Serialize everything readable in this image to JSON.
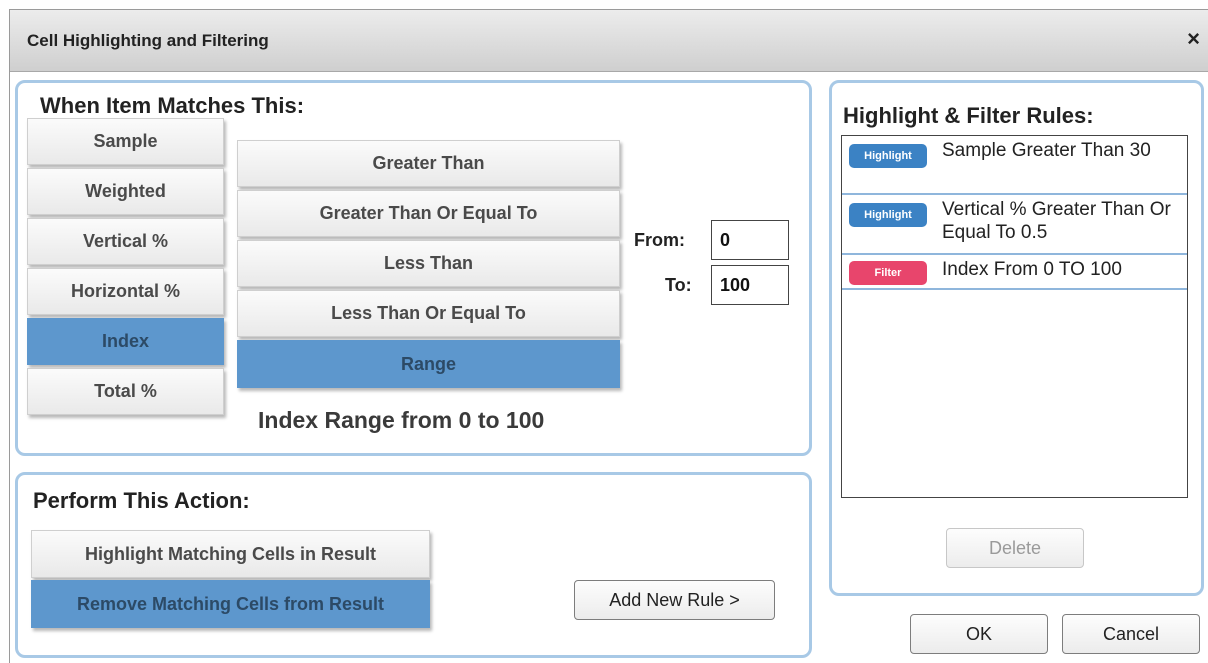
{
  "dialog": {
    "title": "Cell Highlighting and Filtering",
    "close_glyph": "×"
  },
  "match_panel": {
    "title": "When Item Matches This:",
    "fields": [
      "Sample",
      "Weighted",
      "Vertical %",
      "Horizontal %",
      "Index",
      "Total %"
    ],
    "selected_field": "Index",
    "conditions": [
      "Greater Than",
      "Greater Than Or Equal To",
      "Less Than",
      "Less Than Or Equal To",
      "Range"
    ],
    "selected_condition": "Range",
    "from_label": "From:",
    "from_value": "0",
    "to_label": "To:",
    "to_value": "100",
    "summary": "Index Range from 0 to 100"
  },
  "action_panel": {
    "title": "Perform This Action:",
    "actions": [
      "Highlight Matching Cells in Result",
      "Remove Matching Cells from Result"
    ],
    "selected_action": "Remove Matching Cells from Result",
    "add_rule_label": "Add New Rule >"
  },
  "rules_panel": {
    "title": "Highlight & Filter Rules:",
    "rules": [
      {
        "badge": "Highlight",
        "badge_color": "#3b82c4",
        "text": "Sample Greater Than 30"
      },
      {
        "badge": "Highlight",
        "badge_color": "#3b82c4",
        "text": "Vertical % Greater Than Or Equal To 0.5"
      },
      {
        "badge": "Filter",
        "badge_color": "#e8456c",
        "text": "Index From 0 TO 100"
      }
    ],
    "delete_label": "Delete"
  },
  "footer": {
    "ok_label": "OK",
    "cancel_label": "Cancel"
  },
  "colors": {
    "selected": "#5d97cd",
    "panel_border": "#a8c9e6"
  }
}
